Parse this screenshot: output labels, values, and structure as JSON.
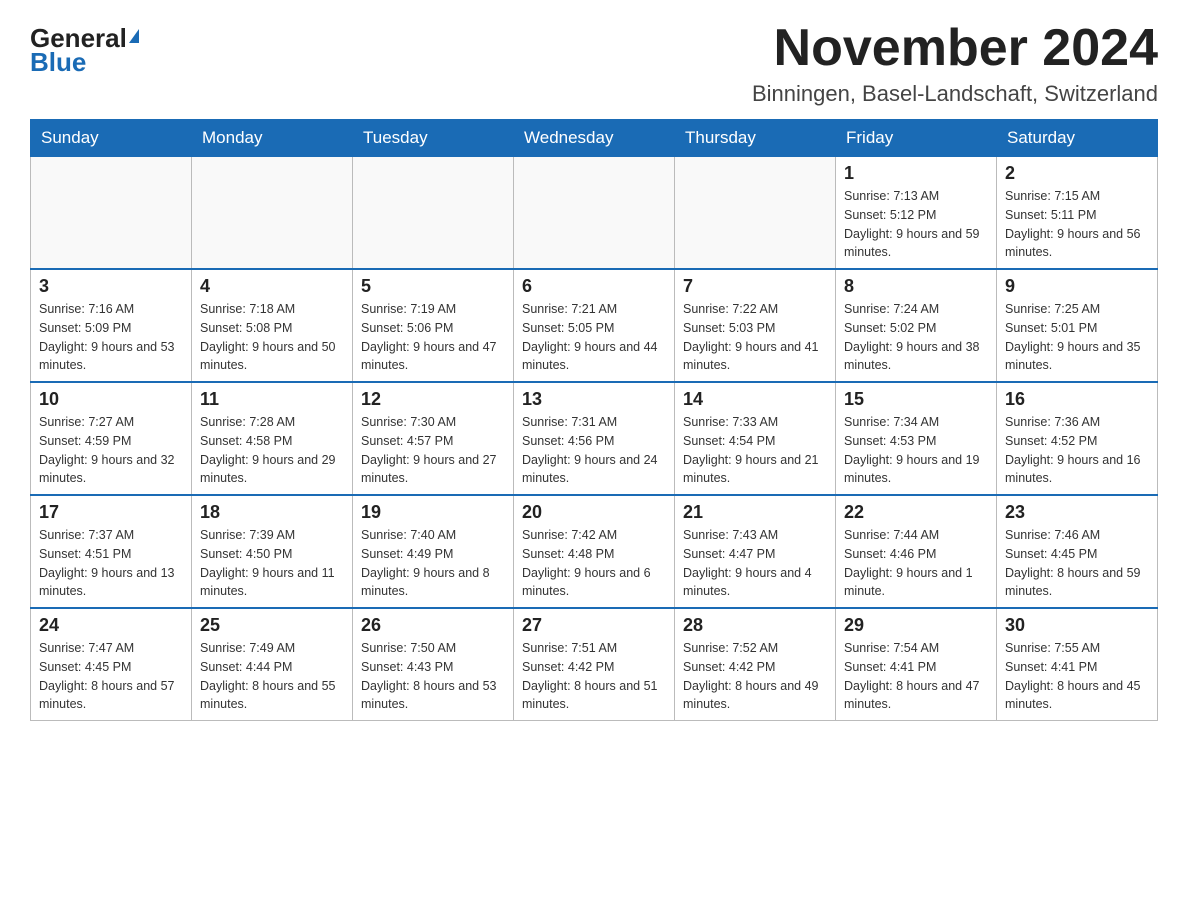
{
  "header": {
    "logo_general": "General",
    "logo_blue": "Blue",
    "month_title": "November 2024",
    "location": "Binningen, Basel-Landschaft, Switzerland"
  },
  "weekdays": [
    "Sunday",
    "Monday",
    "Tuesday",
    "Wednesday",
    "Thursday",
    "Friday",
    "Saturday"
  ],
  "weeks": [
    [
      {
        "day": "",
        "sunrise": "",
        "sunset": "",
        "daylight": ""
      },
      {
        "day": "",
        "sunrise": "",
        "sunset": "",
        "daylight": ""
      },
      {
        "day": "",
        "sunrise": "",
        "sunset": "",
        "daylight": ""
      },
      {
        "day": "",
        "sunrise": "",
        "sunset": "",
        "daylight": ""
      },
      {
        "day": "",
        "sunrise": "",
        "sunset": "",
        "daylight": ""
      },
      {
        "day": "1",
        "sunrise": "Sunrise: 7:13 AM",
        "sunset": "Sunset: 5:12 PM",
        "daylight": "Daylight: 9 hours and 59 minutes."
      },
      {
        "day": "2",
        "sunrise": "Sunrise: 7:15 AM",
        "sunset": "Sunset: 5:11 PM",
        "daylight": "Daylight: 9 hours and 56 minutes."
      }
    ],
    [
      {
        "day": "3",
        "sunrise": "Sunrise: 7:16 AM",
        "sunset": "Sunset: 5:09 PM",
        "daylight": "Daylight: 9 hours and 53 minutes."
      },
      {
        "day": "4",
        "sunrise": "Sunrise: 7:18 AM",
        "sunset": "Sunset: 5:08 PM",
        "daylight": "Daylight: 9 hours and 50 minutes."
      },
      {
        "day": "5",
        "sunrise": "Sunrise: 7:19 AM",
        "sunset": "Sunset: 5:06 PM",
        "daylight": "Daylight: 9 hours and 47 minutes."
      },
      {
        "day": "6",
        "sunrise": "Sunrise: 7:21 AM",
        "sunset": "Sunset: 5:05 PM",
        "daylight": "Daylight: 9 hours and 44 minutes."
      },
      {
        "day": "7",
        "sunrise": "Sunrise: 7:22 AM",
        "sunset": "Sunset: 5:03 PM",
        "daylight": "Daylight: 9 hours and 41 minutes."
      },
      {
        "day": "8",
        "sunrise": "Sunrise: 7:24 AM",
        "sunset": "Sunset: 5:02 PM",
        "daylight": "Daylight: 9 hours and 38 minutes."
      },
      {
        "day": "9",
        "sunrise": "Sunrise: 7:25 AM",
        "sunset": "Sunset: 5:01 PM",
        "daylight": "Daylight: 9 hours and 35 minutes."
      }
    ],
    [
      {
        "day": "10",
        "sunrise": "Sunrise: 7:27 AM",
        "sunset": "Sunset: 4:59 PM",
        "daylight": "Daylight: 9 hours and 32 minutes."
      },
      {
        "day": "11",
        "sunrise": "Sunrise: 7:28 AM",
        "sunset": "Sunset: 4:58 PM",
        "daylight": "Daylight: 9 hours and 29 minutes."
      },
      {
        "day": "12",
        "sunrise": "Sunrise: 7:30 AM",
        "sunset": "Sunset: 4:57 PM",
        "daylight": "Daylight: 9 hours and 27 minutes."
      },
      {
        "day": "13",
        "sunrise": "Sunrise: 7:31 AM",
        "sunset": "Sunset: 4:56 PM",
        "daylight": "Daylight: 9 hours and 24 minutes."
      },
      {
        "day": "14",
        "sunrise": "Sunrise: 7:33 AM",
        "sunset": "Sunset: 4:54 PM",
        "daylight": "Daylight: 9 hours and 21 minutes."
      },
      {
        "day": "15",
        "sunrise": "Sunrise: 7:34 AM",
        "sunset": "Sunset: 4:53 PM",
        "daylight": "Daylight: 9 hours and 19 minutes."
      },
      {
        "day": "16",
        "sunrise": "Sunrise: 7:36 AM",
        "sunset": "Sunset: 4:52 PM",
        "daylight": "Daylight: 9 hours and 16 minutes."
      }
    ],
    [
      {
        "day": "17",
        "sunrise": "Sunrise: 7:37 AM",
        "sunset": "Sunset: 4:51 PM",
        "daylight": "Daylight: 9 hours and 13 minutes."
      },
      {
        "day": "18",
        "sunrise": "Sunrise: 7:39 AM",
        "sunset": "Sunset: 4:50 PM",
        "daylight": "Daylight: 9 hours and 11 minutes."
      },
      {
        "day": "19",
        "sunrise": "Sunrise: 7:40 AM",
        "sunset": "Sunset: 4:49 PM",
        "daylight": "Daylight: 9 hours and 8 minutes."
      },
      {
        "day": "20",
        "sunrise": "Sunrise: 7:42 AM",
        "sunset": "Sunset: 4:48 PM",
        "daylight": "Daylight: 9 hours and 6 minutes."
      },
      {
        "day": "21",
        "sunrise": "Sunrise: 7:43 AM",
        "sunset": "Sunset: 4:47 PM",
        "daylight": "Daylight: 9 hours and 4 minutes."
      },
      {
        "day": "22",
        "sunrise": "Sunrise: 7:44 AM",
        "sunset": "Sunset: 4:46 PM",
        "daylight": "Daylight: 9 hours and 1 minute."
      },
      {
        "day": "23",
        "sunrise": "Sunrise: 7:46 AM",
        "sunset": "Sunset: 4:45 PM",
        "daylight": "Daylight: 8 hours and 59 minutes."
      }
    ],
    [
      {
        "day": "24",
        "sunrise": "Sunrise: 7:47 AM",
        "sunset": "Sunset: 4:45 PM",
        "daylight": "Daylight: 8 hours and 57 minutes."
      },
      {
        "day": "25",
        "sunrise": "Sunrise: 7:49 AM",
        "sunset": "Sunset: 4:44 PM",
        "daylight": "Daylight: 8 hours and 55 minutes."
      },
      {
        "day": "26",
        "sunrise": "Sunrise: 7:50 AM",
        "sunset": "Sunset: 4:43 PM",
        "daylight": "Daylight: 8 hours and 53 minutes."
      },
      {
        "day": "27",
        "sunrise": "Sunrise: 7:51 AM",
        "sunset": "Sunset: 4:42 PM",
        "daylight": "Daylight: 8 hours and 51 minutes."
      },
      {
        "day": "28",
        "sunrise": "Sunrise: 7:52 AM",
        "sunset": "Sunset: 4:42 PM",
        "daylight": "Daylight: 8 hours and 49 minutes."
      },
      {
        "day": "29",
        "sunrise": "Sunrise: 7:54 AM",
        "sunset": "Sunset: 4:41 PM",
        "daylight": "Daylight: 8 hours and 47 minutes."
      },
      {
        "day": "30",
        "sunrise": "Sunrise: 7:55 AM",
        "sunset": "Sunset: 4:41 PM",
        "daylight": "Daylight: 8 hours and 45 minutes."
      }
    ]
  ]
}
